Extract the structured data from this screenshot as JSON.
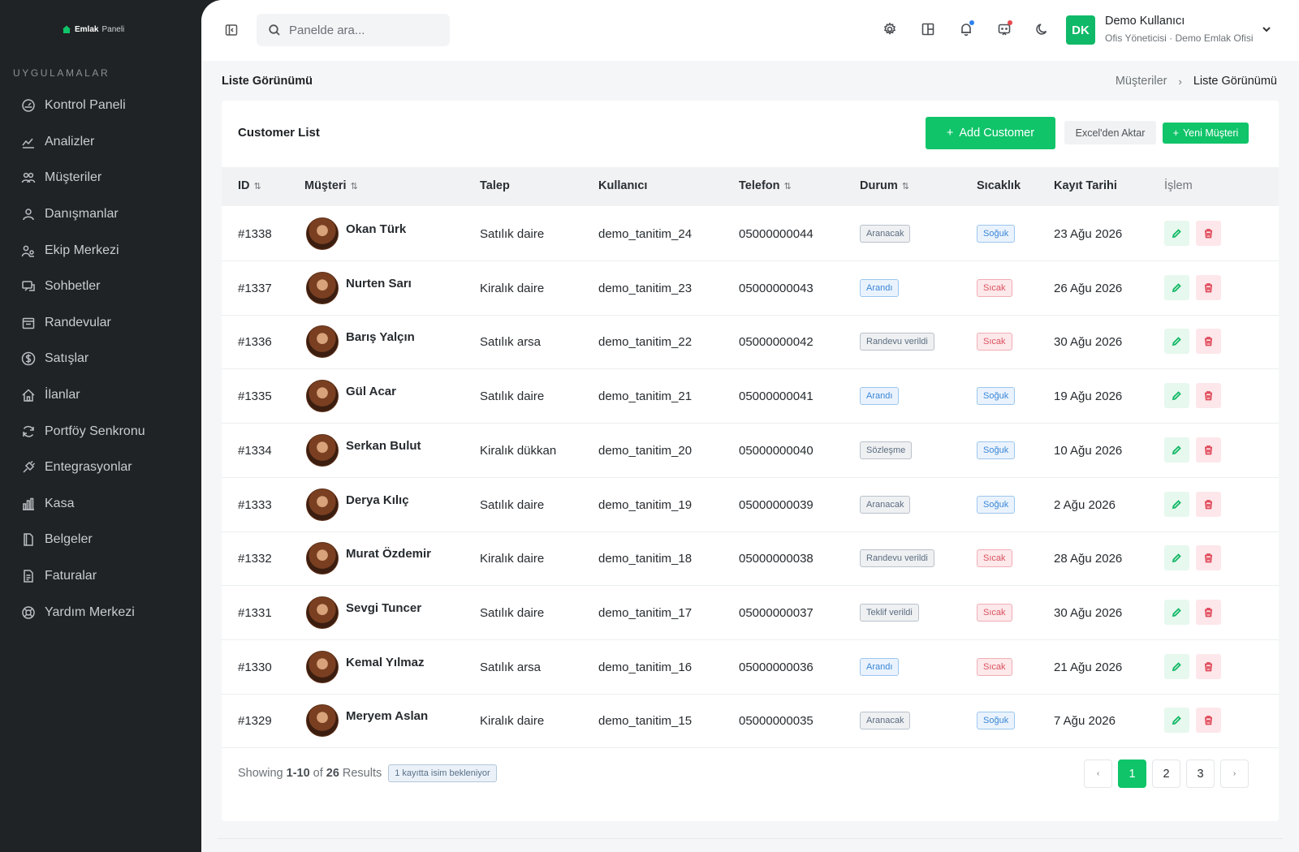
{
  "brand": {
    "name_strong": "Emlak",
    "name_light": "Paneli"
  },
  "sidebar": {
    "section_label": "UYGULAMALAR",
    "items": [
      {
        "label": "Kontrol Paneli",
        "icon": "dashboard-icon"
      },
      {
        "label": "Analizler",
        "icon": "chart-line-icon"
      },
      {
        "label": "Müşteriler",
        "icon": "users-icon"
      },
      {
        "label": "Danışmanlar",
        "icon": "user-icon"
      },
      {
        "label": "Ekip Merkezi",
        "icon": "team-icon"
      },
      {
        "label": "Sohbetler",
        "icon": "chat-icon"
      },
      {
        "label": "Randevular",
        "icon": "calendar-icon"
      },
      {
        "label": "Satışlar",
        "icon": "dollar-icon"
      },
      {
        "label": "İlanlar",
        "icon": "home-icon"
      },
      {
        "label": "Portföy Senkronu",
        "icon": "sync-icon"
      },
      {
        "label": "Entegrasyonlar",
        "icon": "plug-icon"
      },
      {
        "label": "Kasa",
        "icon": "bar-chart-icon"
      },
      {
        "label": "Belgeler",
        "icon": "document-icon"
      },
      {
        "label": "Faturalar",
        "icon": "invoice-icon"
      },
      {
        "label": "Yardım Merkezi",
        "icon": "help-icon"
      }
    ]
  },
  "topbar": {
    "search_placeholder": "Panelde ara...",
    "icons": [
      "settings-icon",
      "layout-icon",
      "bell-icon",
      "message-icon",
      "moon-icon"
    ],
    "user": {
      "initials": "DK",
      "name": "Demo Kullanıcı",
      "role": "Ofis Yöneticisi · Demo Emlak Ofisi"
    }
  },
  "page": {
    "title": "Liste Görünümü",
    "breadcrumb": [
      "Müşteriler",
      "Liste Görünümü"
    ]
  },
  "card": {
    "title": "Customer List",
    "add_label": "Add Customer",
    "excel_label": "Excel'den Aktar",
    "new_label": "Yeni Müşteri"
  },
  "table": {
    "columns": {
      "id": "ID",
      "customer": "Müşteri",
      "request": "Talep",
      "user": "Kullanıcı",
      "phone": "Telefon",
      "status": "Durum",
      "temperature": "Sıcaklık",
      "date": "Kayıt Tarihi",
      "action": "İşlem"
    },
    "rows": [
      {
        "id": "#1338",
        "name": "Okan Türk",
        "request": "Satılık daire",
        "user": "demo_tanitim_24",
        "phone": "05000000044",
        "status": "Aranacak",
        "status_style": "gray",
        "temp": "Soğuk",
        "temp_style": "blue",
        "date": "23 Ağu 2026"
      },
      {
        "id": "#1337",
        "name": "Nurten Sarı",
        "request": "Kiralık daire",
        "user": "demo_tanitim_23",
        "phone": "05000000043",
        "status": "Arandı",
        "status_style": "blue",
        "temp": "Sıcak",
        "temp_style": "red",
        "date": "26 Ağu 2026"
      },
      {
        "id": "#1336",
        "name": "Barış Yalçın",
        "request": "Satılık arsa",
        "user": "demo_tanitim_22",
        "phone": "05000000042",
        "status": "Randevu verildi",
        "status_style": "gray",
        "temp": "Sıcak",
        "temp_style": "red",
        "date": "30 Ağu 2026"
      },
      {
        "id": "#1335",
        "name": "Gül Acar",
        "request": "Satılık daire",
        "user": "demo_tanitim_21",
        "phone": "05000000041",
        "status": "Arandı",
        "status_style": "blue",
        "temp": "Soğuk",
        "temp_style": "blue",
        "date": "19 Ağu 2026"
      },
      {
        "id": "#1334",
        "name": "Serkan Bulut",
        "request": "Kiralık dükkan",
        "user": "demo_tanitim_20",
        "phone": "05000000040",
        "status": "Sözleşme",
        "status_style": "gray",
        "temp": "Soğuk",
        "temp_style": "blue",
        "date": "10 Ağu 2026"
      },
      {
        "id": "#1333",
        "name": "Derya Kılıç",
        "request": "Satılık daire",
        "user": "demo_tanitim_19",
        "phone": "05000000039",
        "status": "Aranacak",
        "status_style": "gray",
        "temp": "Soğuk",
        "temp_style": "blue",
        "date": "2 Ağu 2026"
      },
      {
        "id": "#1332",
        "name": "Murat Özdemir",
        "request": "Kiralık daire",
        "user": "demo_tanitim_18",
        "phone": "05000000038",
        "status": "Randevu verildi",
        "status_style": "gray",
        "temp": "Sıcak",
        "temp_style": "red",
        "date": "28 Ağu 2026"
      },
      {
        "id": "#1331",
        "name": "Sevgi Tuncer",
        "request": "Satılık daire",
        "user": "demo_tanitim_17",
        "phone": "05000000037",
        "status": "Teklif verildi",
        "status_style": "gray",
        "temp": "Sıcak",
        "temp_style": "red",
        "date": "30 Ağu 2026"
      },
      {
        "id": "#1330",
        "name": "Kemal Yılmaz",
        "request": "Satılık arsa",
        "user": "demo_tanitim_16",
        "phone": "05000000036",
        "status": "Arandı",
        "status_style": "blue",
        "temp": "Sıcak",
        "temp_style": "red",
        "date": "21 Ağu 2026"
      },
      {
        "id": "#1329",
        "name": "Meryem Aslan",
        "request": "Kiralık daire",
        "user": "demo_tanitim_15",
        "phone": "05000000035",
        "status": "Aranacak",
        "status_style": "gray",
        "temp": "Soğuk",
        "temp_style": "blue",
        "date": "7 Ağu 2026"
      }
    ]
  },
  "footer": {
    "showing": "Showing",
    "range": "1-10",
    "of": "of",
    "total": "26",
    "results": "Results",
    "pending_badge": "1 kayıtta isim bekleniyor"
  },
  "pagination": {
    "prev": "‹",
    "pages": [
      "1",
      "2",
      "3"
    ],
    "next": "›",
    "current": "1"
  },
  "colors": {
    "accent": "#10c469",
    "sidebar_bg": "#1f2325",
    "bell_dot": "#2f80ed",
    "message_dot": "#e5484d"
  }
}
